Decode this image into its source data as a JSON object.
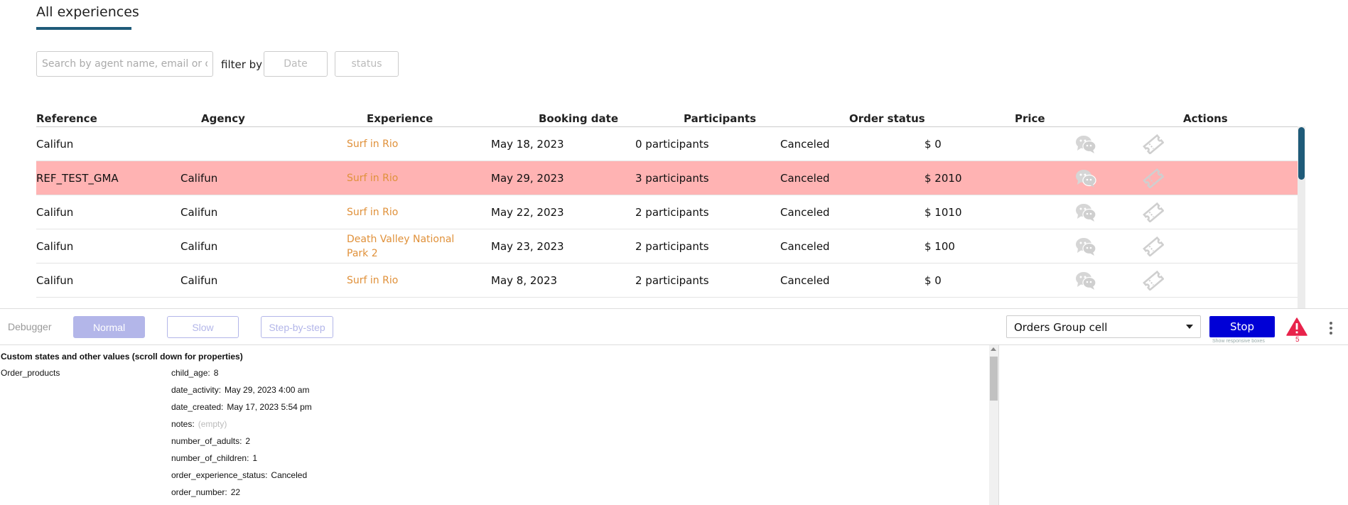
{
  "page": {
    "title": "All experiences",
    "search_placeholder": "Search by agent name, email or company",
    "filter_label": "filter by",
    "filter_date": "Date",
    "filter_status": "status"
  },
  "table": {
    "headers": [
      "Reference",
      "Agency",
      "Experience",
      "Booking date",
      "Participants",
      "Order status",
      "Price",
      "Actions"
    ],
    "rows": [
      {
        "reference": "Califun",
        "agency": "",
        "experience": "Surf in Rio",
        "booking_date": "May 18, 2023",
        "participants": "0 participants",
        "status": "Canceled",
        "price": "$ 0"
      },
      {
        "reference": "REF_TEST_GMA",
        "agency": "Califun",
        "experience": "Surf in Rio",
        "booking_date": "May 29, 2023",
        "participants": "3 participants",
        "status": "Canceled",
        "price": "$ 2010"
      },
      {
        "reference": "Califun",
        "agency": "Califun",
        "experience": "Surf in Rio",
        "booking_date": "May 22, 2023",
        "participants": "2 participants",
        "status": "Canceled",
        "price": "$ 1010"
      },
      {
        "reference": "Califun",
        "agency": "Califun",
        "experience": "Death Valley National Park 2",
        "booking_date": "May 23, 2023",
        "participants": "2 participants",
        "status": "Canceled",
        "price": "$ 100"
      },
      {
        "reference": "Califun",
        "agency": "Califun",
        "experience": "Surf in Rio",
        "booking_date": "May 8, 2023",
        "participants": "2 participants",
        "status": "Canceled",
        "price": "$ 0"
      }
    ],
    "icons": {
      "chat": "chat-bubbles-icon",
      "ticket": "ticket-icon"
    }
  },
  "colors": {
    "highlight_row": "#ffb3b3",
    "experience_link": "#e0913a",
    "accent": "#1f5b79",
    "stop_button": "#0000d6",
    "warning": "#e8234b"
  },
  "debugger": {
    "label": "Debugger",
    "modes": {
      "normal": "Normal",
      "slow": "Slow",
      "step": "Step-by-step"
    },
    "selected_mode": "Normal",
    "element_select": "Orders Group cell",
    "stop_label": "Stop",
    "responsive_link": "Show responsive boxes",
    "warning_count": "5",
    "heading": "Custom states and other values (scroll down for properties)",
    "group": "Order_products",
    "props": [
      {
        "key": "child_age:",
        "value": "8"
      },
      {
        "key": "date_activity:",
        "value": "May 29, 2023 4:00 am"
      },
      {
        "key": "date_created:",
        "value": "May 17, 2023 5:54 pm"
      },
      {
        "key": "notes:",
        "value": "(empty)",
        "empty": true
      },
      {
        "key": "number_of_adults:",
        "value": "2"
      },
      {
        "key": "number_of_children:",
        "value": "1"
      },
      {
        "key": "order_experience_status:",
        "value": "Canceled"
      },
      {
        "key": "order_number:",
        "value": "22"
      }
    ]
  }
}
